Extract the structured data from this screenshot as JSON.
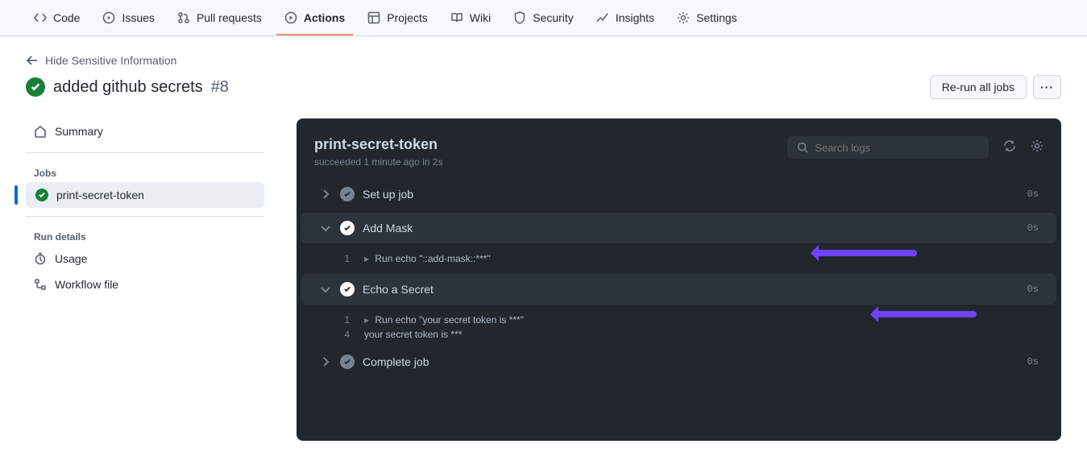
{
  "nav": {
    "items": [
      {
        "label": "Code"
      },
      {
        "label": "Issues"
      },
      {
        "label": "Pull requests"
      },
      {
        "label": "Actions"
      },
      {
        "label": "Projects"
      },
      {
        "label": "Wiki"
      },
      {
        "label": "Security"
      },
      {
        "label": "Insights"
      },
      {
        "label": "Settings"
      }
    ]
  },
  "header": {
    "back_label": "Hide Sensitive Information",
    "title": "added github secrets",
    "run_number": "#8",
    "rerun_label": "Re-run all jobs",
    "more_label": "···"
  },
  "sidebar": {
    "summary_label": "Summary",
    "jobs_heading": "Jobs",
    "job_name": "print-secret-token",
    "run_details_heading": "Run details",
    "usage_label": "Usage",
    "workflow_file_label": "Workflow file"
  },
  "log": {
    "title": "print-secret-token",
    "subtitle": "succeeded 1 minute ago in 2s",
    "search_placeholder": "Search logs",
    "steps": [
      {
        "name": "Set up job",
        "duration": "0s"
      },
      {
        "name": "Add Mask",
        "duration": "0s"
      },
      {
        "name": "Echo a Secret",
        "duration": "0s"
      },
      {
        "name": "Complete job",
        "duration": "0s"
      }
    ],
    "addmask_lines": {
      "l1_num": "1",
      "l1_txt": "Run echo \"::add-mask::***\""
    },
    "echo_lines": {
      "l1_num": "1",
      "l1_txt": "Run echo \"your secret token is ***\"",
      "l4_num": "4",
      "l4_txt": "your secret token is ***"
    }
  }
}
